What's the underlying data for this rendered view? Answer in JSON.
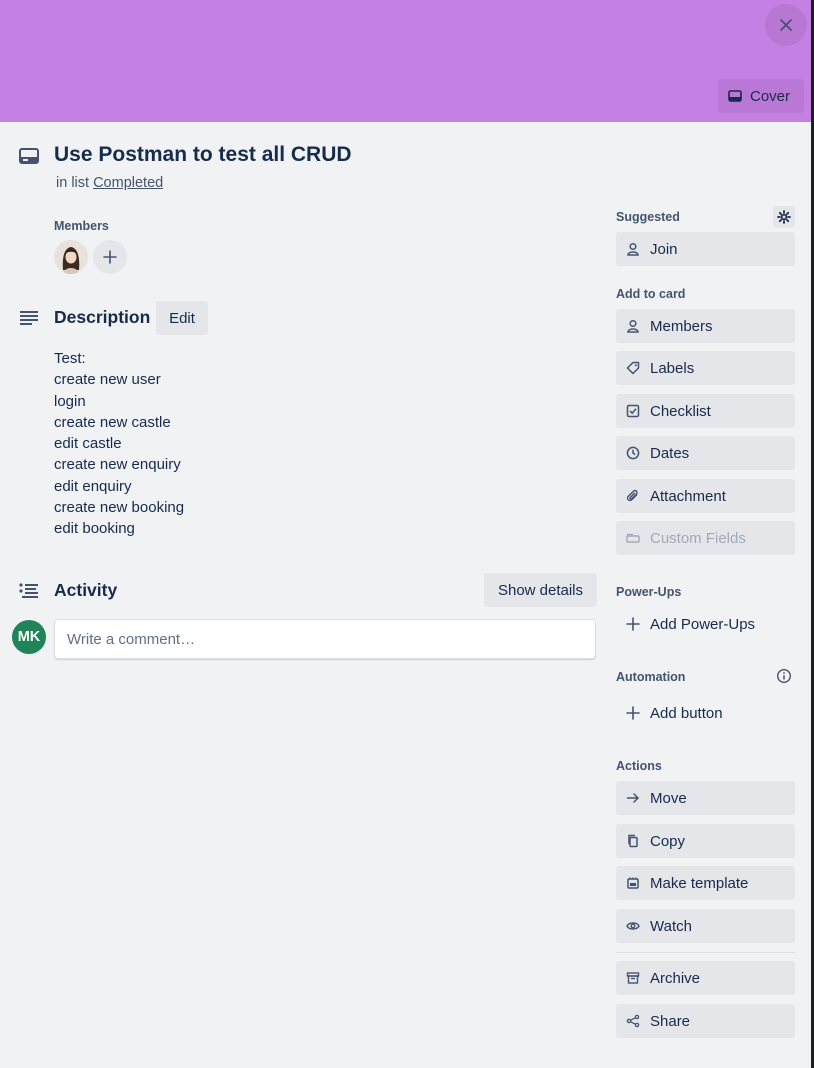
{
  "card": {
    "title": "Use Postman to test all CRUD",
    "in_list_prefix": "in list",
    "list_name": "Completed",
    "cover_color": "#c580e3"
  },
  "header": {
    "cover_label": "Cover"
  },
  "members": {
    "label": "Members",
    "avatar_icon": "member-photo-icon",
    "add_icon": "plus-icon"
  },
  "description": {
    "title": "Description",
    "edit_label": "Edit",
    "lines": [
      "Test:",
      "create new user",
      "login",
      "create new castle",
      "edit castle",
      "create new enquiry",
      "edit enquiry",
      "create new booking",
      "edit booking"
    ]
  },
  "activity": {
    "title": "Activity",
    "show_details_label": "Show details",
    "user_initials": "MK",
    "user_color": "#1f845a",
    "comment_placeholder": "Write a comment…"
  },
  "sidebar": {
    "suggested_label": "Suggested",
    "join_label": "Join",
    "add_to_card_label": "Add to card",
    "add_to_card": [
      "Members",
      "Labels",
      "Checklist",
      "Dates",
      "Attachment",
      "Custom Fields"
    ],
    "powerups_label": "Power-Ups",
    "add_powerups_label": "Add Power-Ups",
    "automation_label": "Automation",
    "add_button_label": "Add button",
    "actions_label": "Actions",
    "actions": [
      "Move",
      "Copy",
      "Make template",
      "Watch"
    ],
    "archive_label": "Archive",
    "share_label": "Share"
  }
}
